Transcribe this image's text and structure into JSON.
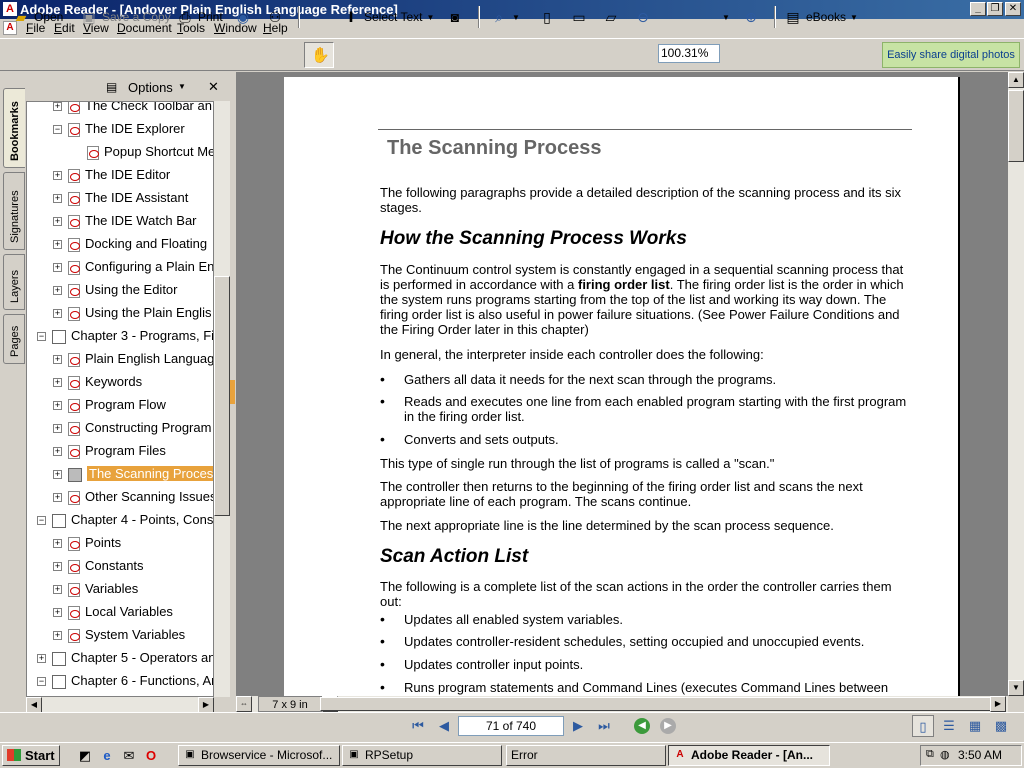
{
  "window": {
    "title": "Adobe Reader - [Andover Plain English Language Reference]",
    "controls": [
      "_",
      "❐",
      "✕"
    ]
  },
  "menubar": {
    "items": [
      "File",
      "Edit",
      "View",
      "Document",
      "Tools",
      "Window",
      "Help"
    ]
  },
  "toolbar": {
    "open_label": "Open",
    "save_copy_label": "Save a Copy",
    "print_label": "Print",
    "select_text_label": "Select Text",
    "zoom_value": "100.31%",
    "ebooks_label": "eBooks",
    "ad_text": "Easily share digital photos"
  },
  "nav_panel": {
    "tabs": [
      "Bookmarks",
      "Signatures",
      "Layers",
      "Pages"
    ],
    "options_label": "Options",
    "close_glyph": "✕",
    "bookmarks": [
      {
        "label": "The Check Toolbar an"
      },
      {
        "label": "The IDE Explorer"
      },
      {
        "label": "Popup Shortcut Me"
      },
      {
        "label": "The IDE Editor"
      },
      {
        "label": "The IDE Assistant"
      },
      {
        "label": "The IDE Watch Bar"
      },
      {
        "label": "Docking and Floating"
      },
      {
        "label": "Configuring a Plain En"
      },
      {
        "label": "Using the Editor"
      },
      {
        "label": "Using the Plain Englis"
      },
      {
        "label": "Chapter 3 - Programs, Fil"
      },
      {
        "label": "Plain English Languag"
      },
      {
        "label": "Keywords"
      },
      {
        "label": "Program Flow"
      },
      {
        "label": "Constructing Program"
      },
      {
        "label": "Program Files"
      },
      {
        "label": "The Scanning Proces"
      },
      {
        "label": "Other Scanning Issues"
      },
      {
        "label": "Chapter 4 - Points, Const"
      },
      {
        "label": "Points"
      },
      {
        "label": "Constants"
      },
      {
        "label": "Variables"
      },
      {
        "label": "Local Variables"
      },
      {
        "label": "System Variables"
      },
      {
        "label": "Chapter 5 - Operators and"
      },
      {
        "label": "Chapter 6 - Functions, Ar"
      }
    ]
  },
  "document": {
    "heading": "The Scanning Process",
    "intro": "The following paragraphs provide a detailed description of the scanning process and its six stages.",
    "section1_title": "How the Scanning Process Works",
    "para1_a": "The Continuum control system is constantly engaged in a sequential scanning process that is performed in accordance with a ",
    "para1_bold": "firing order list",
    "para1_b": ". The firing order list is the order in which the system runs programs starting from the top of the list and working its way down. The firing order list is also useful in power failure situations. (See Power Failure Conditions and the Firing Order later in this chapter)",
    "para2": "In general, the interpreter inside each controller does the following:",
    "bullets1": [
      "Gathers all data it needs for the next scan through the programs.",
      "Reads and executes one line from each enabled program starting with the first program in the firing order list.",
      "Converts and sets outputs."
    ],
    "para3": "This type of single run through the list of programs is called a \"scan.\"",
    "para4": "The controller then returns to the beginning of the firing order list and scans the next appropriate line of each program.  The scans continue.",
    "para5": "The next appropriate line is the line determined by the scan process sequence.",
    "section2_title": "Scan Action List",
    "para6": "The following is a complete list of the scan actions in the order the controller carries them out:",
    "bullets2": [
      "Updates all enabled system variables.",
      "Updates controller-resident schedules, setting occupied and unoccupied events.",
      "Updates controller input points.",
      "Runs program statements and Command Lines (executes Command Lines between program lines only)"
    ],
    "page_size": "7 x 9 in"
  },
  "navigation": {
    "page_indicator": "71 of 740"
  },
  "taskbar": {
    "start_label": "Start",
    "tasks": [
      "Browservice - Microsof...",
      "RPSetup",
      "Error",
      "Adobe Reader - [An..."
    ],
    "clock": "3:50 AM"
  }
}
